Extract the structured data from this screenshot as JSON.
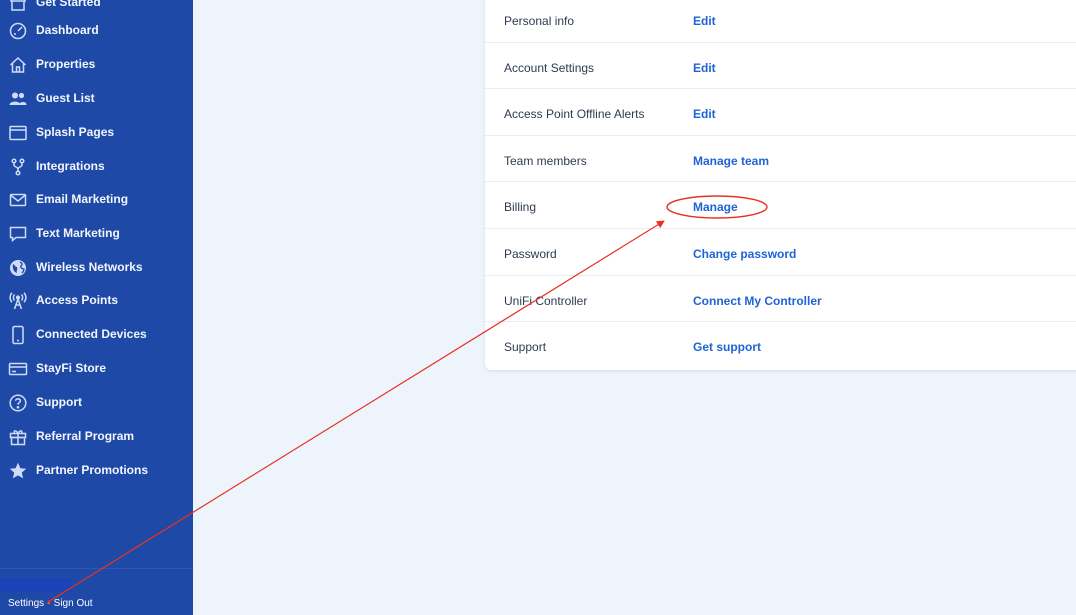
{
  "sidebar": {
    "items": [
      {
        "label": "Get Started",
        "icon": "store-icon"
      },
      {
        "label": "Dashboard",
        "icon": "gauge-icon"
      },
      {
        "label": "Properties",
        "icon": "home-icon"
      },
      {
        "label": "Guest List",
        "icon": "users-icon"
      },
      {
        "label": "Splash Pages",
        "icon": "browser-window-icon"
      },
      {
        "label": "Integrations",
        "icon": "branch-icon"
      },
      {
        "label": "Email Marketing",
        "icon": "envelope-icon"
      },
      {
        "label": "Text Marketing",
        "icon": "chat-bubble-icon"
      },
      {
        "label": "Wireless Networks",
        "icon": "globe-icon"
      },
      {
        "label": "Access Points",
        "icon": "antenna-icon"
      },
      {
        "label": "Connected Devices",
        "icon": "phone-icon"
      },
      {
        "label": "StayFi Store",
        "icon": "credit-card-icon"
      },
      {
        "label": "Support",
        "icon": "question-circle-icon"
      },
      {
        "label": "Referral Program",
        "icon": "gift-icon"
      },
      {
        "label": "Partner Promotions",
        "icon": "star-icon"
      }
    ],
    "footer": {
      "settings_label": "Settings",
      "separator": "•",
      "signout_label": "Sign Out"
    }
  },
  "settings": {
    "rows": [
      {
        "label": "Personal info",
        "action": "Edit"
      },
      {
        "label": "Account Settings",
        "action": "Edit"
      },
      {
        "label": "Access Point Offline Alerts",
        "action": "Edit"
      },
      {
        "label": "Team members",
        "action": "Manage team"
      },
      {
        "label": "Billing",
        "action": "Manage"
      },
      {
        "label": "Password",
        "action": "Change password"
      },
      {
        "label": "UniFi Controller",
        "action": "Connect My Controller"
      },
      {
        "label": "Support",
        "action": "Get support"
      }
    ]
  },
  "colors": {
    "sidebar_bg": "#1f49a6",
    "page_bg": "#eef4fc",
    "link": "#1f63d6",
    "annotation": "#e8321e"
  }
}
